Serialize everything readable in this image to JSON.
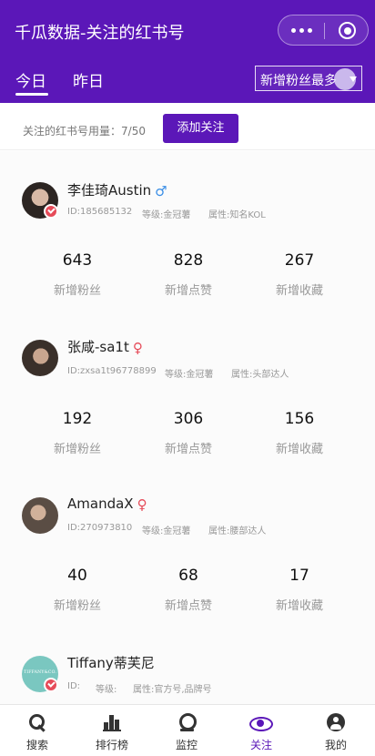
{
  "header": {
    "title": "千瓜数据-关注的红书号",
    "tabs": [
      {
        "label": "今日",
        "active": true
      },
      {
        "label": "昨日",
        "active": false
      }
    ],
    "sort_select": {
      "selected": "新增粉丝最多"
    },
    "accent_color": "#5b17b8"
  },
  "quota": {
    "label": "关注的红书号用量：",
    "used": "7/50",
    "add_button_label": "添加关注"
  },
  "accounts": [
    {
      "name": "李佳琦Austin",
      "gender_icon": "♂",
      "id": "ID:185685132",
      "level": "等级:金冠薯",
      "attribute": "属性:知名KOL",
      "stats": [
        {
          "value": "643",
          "label": "新增粉丝"
        },
        {
          "value": "828",
          "label": "新增点赞"
        },
        {
          "value": "267",
          "label": "新增收藏"
        }
      ]
    },
    {
      "name": "张咸-sa1t",
      "gender_icon": "♀",
      "id": "ID:zxsa1t96778899",
      "level": "等级:金冠薯",
      "attribute": "属性:头部达人",
      "stats": [
        {
          "value": "192",
          "label": "新增粉丝"
        },
        {
          "value": "306",
          "label": "新增点赞"
        },
        {
          "value": "156",
          "label": "新增收藏"
        }
      ]
    },
    {
      "name": "AmandaX",
      "gender_icon": "♀",
      "id": "ID:270973810",
      "level": "等级:金冠薯",
      "attribute": "属性:腰部达人",
      "stats": [
        {
          "value": "40",
          "label": "新增粉丝"
        },
        {
          "value": "68",
          "label": "新增点赞"
        },
        {
          "value": "17",
          "label": "新增收藏"
        }
      ]
    },
    {
      "name": "Tiffany蒂芙尼",
      "avatar_text": "TIFFANY&CO.",
      "id": "ID:",
      "level": "等级:",
      "attribute": "属性:官方号,品牌号"
    }
  ],
  "bottom_nav": [
    {
      "label": "搜索",
      "icon": "search-icon",
      "active": false
    },
    {
      "label": "排行榜",
      "icon": "bar-chart-icon",
      "active": false
    },
    {
      "label": "监控",
      "icon": "camera-icon",
      "active": false
    },
    {
      "label": "关注",
      "icon": "eye-icon",
      "active": true
    },
    {
      "label": "我的",
      "icon": "user-icon",
      "active": false
    }
  ]
}
